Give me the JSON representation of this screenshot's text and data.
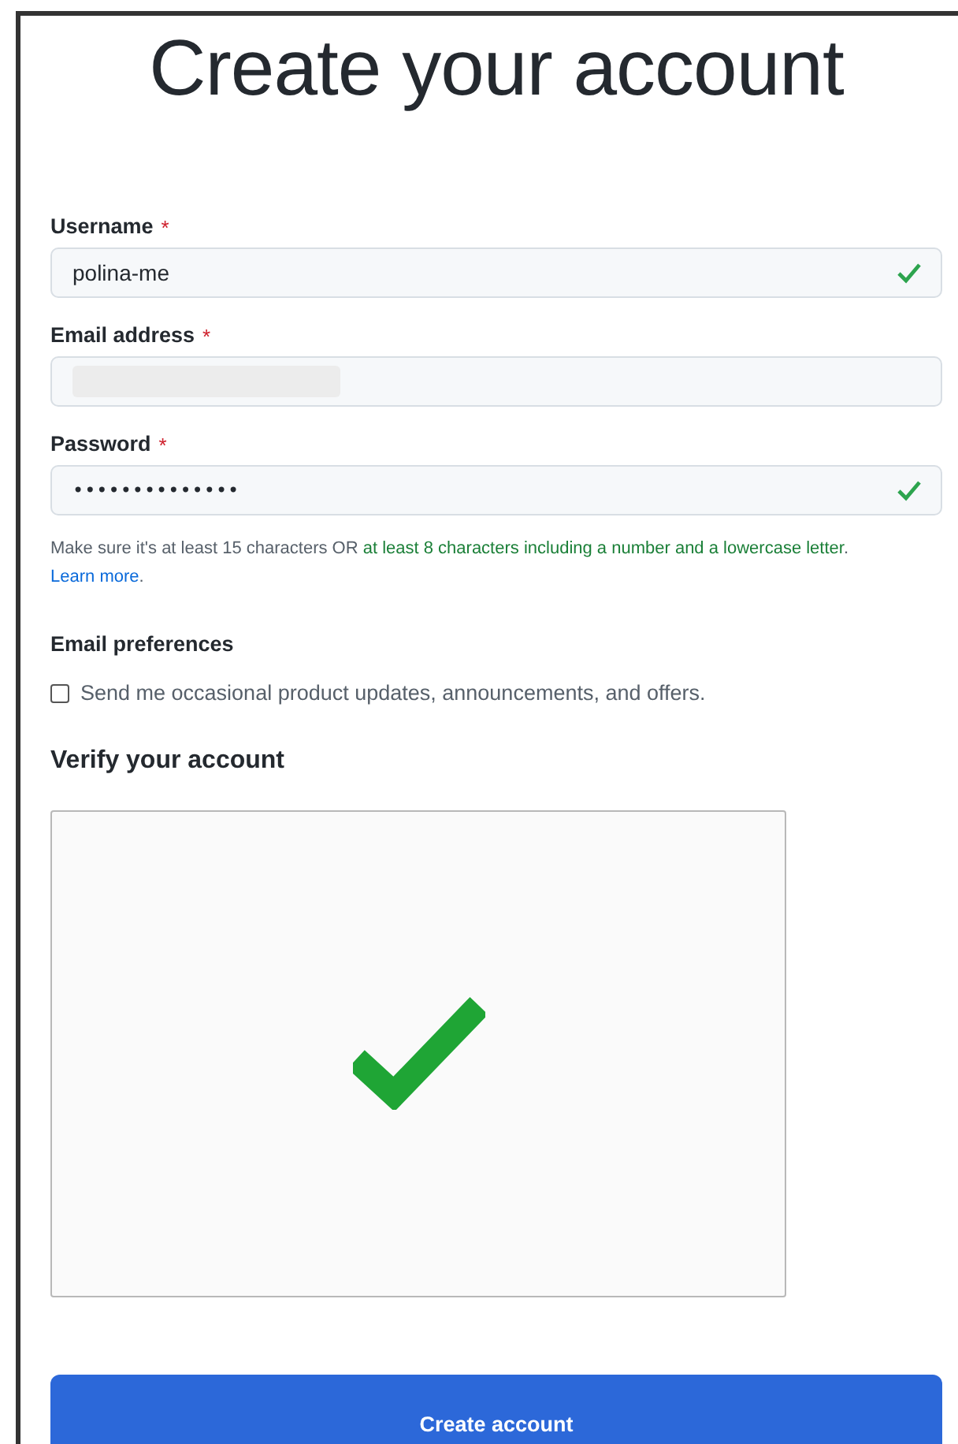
{
  "title": "Create your account",
  "fields": [
    {
      "kind": "text",
      "label": "Username",
      "required_mark": "*",
      "value": "polina-me",
      "valid": true
    },
    {
      "kind": "redacted",
      "label": "Email address",
      "required_mark": "*",
      "valid": false
    },
    {
      "kind": "password",
      "label": "Password",
      "required_mark": "*",
      "value": "••••••••••••••",
      "valid": true
    }
  ],
  "password_hint": [
    {
      "kind": "plain",
      "text": "Make sure it's at least 15 characters OR "
    },
    {
      "kind": "met",
      "text": "at least 8 characters including a number and a lowercase letter"
    },
    {
      "kind": "plain",
      "text": ". "
    },
    {
      "kind": "link",
      "text": "Learn more"
    },
    {
      "kind": "plain",
      "text": "."
    }
  ],
  "email_preferences": {
    "heading": "Email preferences",
    "checkbox_label": "Send me occasional product updates, announcements, and offers.",
    "checked": false
  },
  "verify": {
    "heading": "Verify your account",
    "verified": true
  },
  "submit_button": "Create account"
}
